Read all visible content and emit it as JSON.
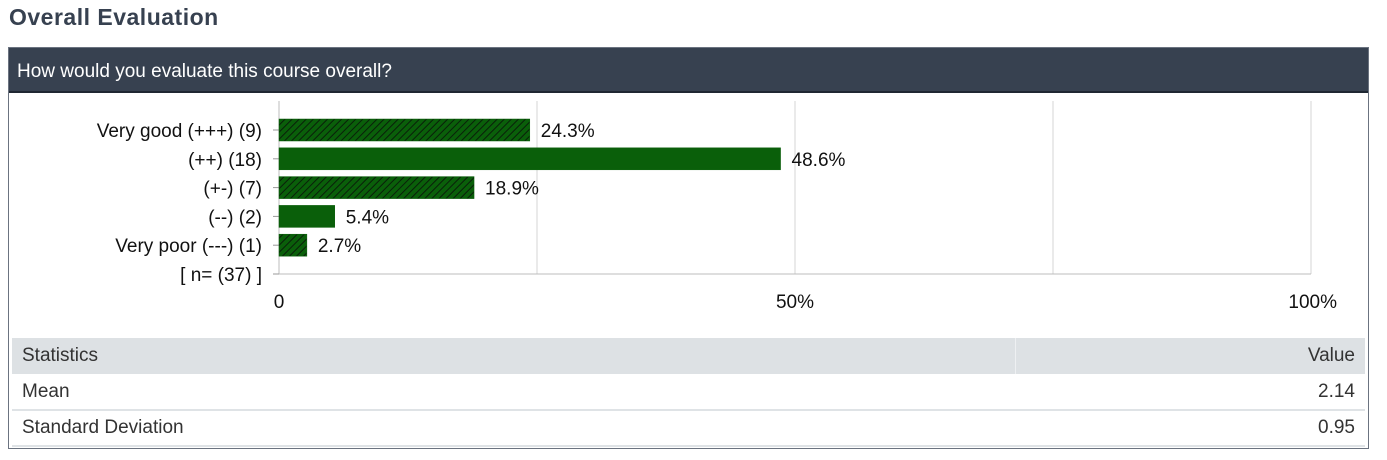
{
  "section": {
    "title": "Overall Evaluation"
  },
  "question": "How would you evaluate this course overall?",
  "colors": {
    "bar": "#0a5f0a",
    "header": "#374150",
    "grid": "#d4d4d4"
  },
  "chart_data": {
    "type": "bar",
    "orientation": "horizontal",
    "categories": [
      "Very good (+++) (9)",
      "(++) (18)",
      "(+-) (7)",
      "(--) (2)",
      "Very poor (---) (1)"
    ],
    "values": [
      24.3,
      48.6,
      18.9,
      5.4,
      2.7
    ],
    "value_labels": [
      "24.3%",
      "48.6%",
      "18.9%",
      "5.4%",
      "2.7%"
    ],
    "hatched": [
      true,
      false,
      true,
      false,
      true
    ],
    "n_label": "[ n= (37) ]",
    "xlim": [
      0,
      100
    ],
    "x_ticks": [
      {
        "value": 0,
        "label": "0"
      },
      {
        "value": 50,
        "label": "50%"
      },
      {
        "value": 100,
        "label": "100%"
      }
    ],
    "gridlines": [
      25,
      50,
      75,
      100
    ],
    "grid": true
  },
  "stats": {
    "header": {
      "label": "Statistics",
      "value": "Value"
    },
    "rows": [
      {
        "label": "Mean",
        "value": "2.14"
      },
      {
        "label": "Standard Deviation",
        "value": "0.95"
      }
    ]
  }
}
